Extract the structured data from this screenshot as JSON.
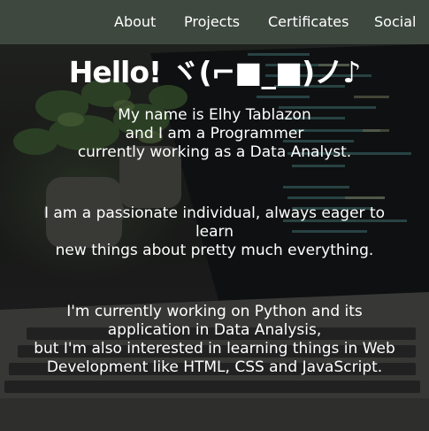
{
  "nav": {
    "items": [
      "About",
      "Projects",
      "Certificates",
      "Social"
    ]
  },
  "hero": {
    "greeting": "Hello! ヾ(⌐■_■)ノ♪",
    "intro_lines": [
      "My name is Elhy Tablazon",
      "and I am a Programmer",
      "currently working as a Data Analyst."
    ],
    "passion_lines": [
      "I am a passionate individual, always eager to",
      "learn",
      "new things about pretty much everything."
    ],
    "current_lines": [
      "I'm currently working on Python and its",
      "application in Data Analysis,",
      "but I'm also interested in learning things in Web",
      "Development like HTML, CSS and JavaScript."
    ]
  },
  "colors": {
    "navbar": "#3e483f",
    "text": "#ffffff"
  }
}
